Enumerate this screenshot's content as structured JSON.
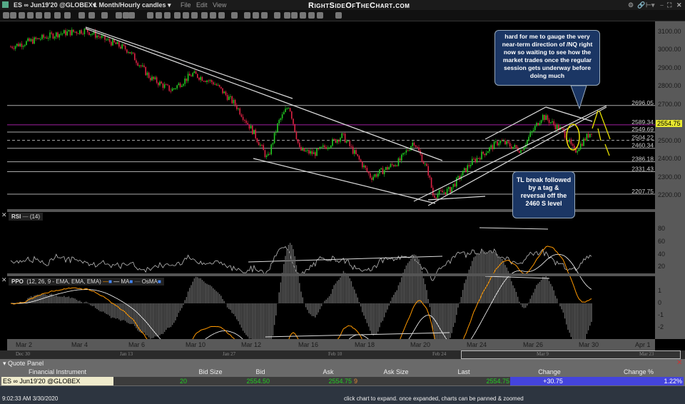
{
  "titlebar": {
    "symbol": "ES ∞ Jun19'20 @GLOBEX▾",
    "timeframe": "1 Month/Hourly candles ▾",
    "menus": [
      "File",
      "Edit",
      "View"
    ],
    "brand": "RightSideOfTheChart.com"
  },
  "price_axis": {
    "ticks": [
      "3100.00",
      "3000.00",
      "2900.00",
      "2800.00",
      "2700.00",
      "2600.00",
      "2500.00",
      "2400.00",
      "2300.00",
      "2200.00"
    ],
    "last": "2554.75",
    "last_color": "#e8e830"
  },
  "levels": [
    {
      "label": "2696.05",
      "value": 2696.05,
      "color": "#aaaaaa"
    },
    {
      "label": "2589.34",
      "value": 2589.34,
      "color": "#a020a0"
    },
    {
      "label": "2549.69",
      "value": 2549.69,
      "color": "#aaaaaa"
    },
    {
      "label": "2504.22",
      "value": 2504.22,
      "color": "#aaaaaa",
      "dashed": true
    },
    {
      "label": "2460.34",
      "value": 2460.34,
      "color": "#aaaaaa"
    },
    {
      "label": "2386.18",
      "value": 2386.18,
      "color": "#aaaaaa"
    },
    {
      "label": "2331.43",
      "value": 2331.43,
      "color": "#aaaaaa"
    },
    {
      "label": "2207.75",
      "value": 2207.75,
      "color": "#aaaaaa"
    }
  ],
  "annotations": {
    "top": "hard for me to gauge the very near-term direction of /NQ right now so waiting to see how the market trades once the regular session gets underway before doing much",
    "bottom": "TL break followed by a tag & reversal off the 2460 S level"
  },
  "rsi": {
    "name": "RSI",
    "params": "(14)",
    "ticks": [
      "80",
      "60",
      "40",
      "20"
    ]
  },
  "ppo": {
    "name": "PPO",
    "params": "(12, 26, 9 - EMA, EMA, EMA)",
    "ma": "MA",
    "osma": "OsMA",
    "ticks": [
      "1",
      "0",
      "-1",
      "-2"
    ]
  },
  "date_axis": [
    "Mar 2",
    "Mar 4",
    "Mar 6",
    "Mar 10",
    "Mar 12",
    "Mar 16",
    "Mar 18",
    "Mar 20",
    "Mar 24",
    "Mar 26",
    "Mar 30",
    "Apr 1"
  ],
  "scroller": [
    "Dec 30",
    "Jan 13",
    "Jan 27",
    "Feb 10",
    "Feb 24",
    "Mar 9",
    "Mar 23"
  ],
  "quote_panel": {
    "title": "Quote Panel",
    "headers": [
      "Financial Instrument",
      "Bid Size",
      "Bid",
      "Ask",
      "Ask Size",
      "Last",
      "Change",
      "Change %"
    ],
    "row": {
      "instrument": "ES ∞ Jun19'20 @GLOBEX",
      "bid_size": "20",
      "bid": "2554.50",
      "ask": "2554.75",
      "ask_size": "9",
      "last": "2554.75",
      "change": "+30.75",
      "change_pct": "1.22%"
    }
  },
  "status": {
    "time": "9:02:33 AM 3/30/2020",
    "hint": "click chart to expand. once expanded, charts can be panned & zoomed"
  },
  "colors": {
    "up": "#22cc22",
    "down": "#dd2244",
    "change_bg": "#4444dd"
  }
}
